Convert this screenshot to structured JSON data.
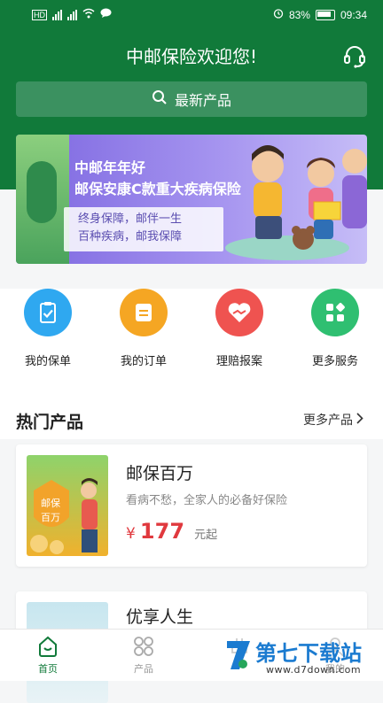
{
  "status_bar": {
    "battery": "83%",
    "time": "09:34"
  },
  "header": {
    "title": "中邮保险欢迎您!"
  },
  "search": {
    "label": "最新产品"
  },
  "banner": {
    "line1": "中邮年年好",
    "line2": "邮保安康C款重大疾病保险",
    "sub1": "终身保障，邮伴一生",
    "sub2": "百种疾病，邮我保障"
  },
  "quick_actions": [
    {
      "label": "我的保单",
      "icon": "policy-icon",
      "color": "#2fa8f0"
    },
    {
      "label": "我的订单",
      "icon": "order-icon",
      "color": "#f5a623"
    },
    {
      "label": "理赔报案",
      "icon": "claim-heart-icon",
      "color": "#ef5350"
    },
    {
      "label": "更多服务",
      "icon": "more-services-icon",
      "color": "#2fbf71"
    }
  ],
  "hot": {
    "title": "热门产品",
    "more": "更多产品"
  },
  "products": [
    {
      "name": "邮保百万",
      "desc": "看病不愁，全家人的必备好保险",
      "price_symbol": "¥",
      "price": "177",
      "price_unit": "元起",
      "thumb_text": "邮保\n百万"
    },
    {
      "name": "优享人生"
    }
  ],
  "tabs": [
    {
      "label": "首页",
      "icon": "home-icon",
      "active": true
    },
    {
      "label": "产品",
      "icon": "products-grid-icon",
      "active": false
    },
    {
      "label": "",
      "icon": "service-icon",
      "active": false
    },
    {
      "label": "我的",
      "icon": "profile-icon",
      "active": false
    }
  ],
  "watermark": {
    "brand": "第七下载站",
    "url": "www.d7down.com"
  },
  "colors": {
    "primary": "#117a3a",
    "price": "#e0393e"
  }
}
